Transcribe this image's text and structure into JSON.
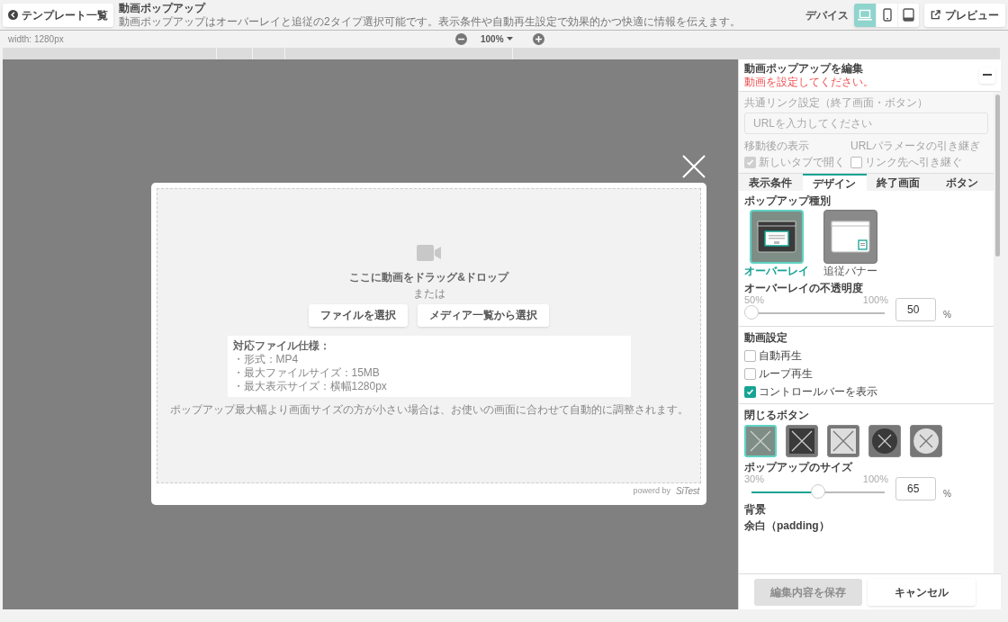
{
  "header": {
    "back_button": "テンプレート一覧",
    "title": "動画ポップアップ",
    "description": "動画ポップアップはオーバーレイと追従の2タイプ選択可能です。表示条件や自動再生設定で効果的かつ快適に情報を伝えます。",
    "device_label": "デバイス",
    "devices": [
      {
        "kind": "desktop",
        "selected": true
      },
      {
        "kind": "phone",
        "selected": false
      },
      {
        "kind": "tablet",
        "selected": false
      }
    ],
    "preview_button": "プレビュー"
  },
  "toolbar": {
    "width_label": "width: 1280px",
    "zoom": "100%"
  },
  "popup": {
    "drop_text": "ここに動画をドラッグ&ドロップ",
    "or_text": "または",
    "buttons": [
      "ファイルを選択",
      "メディア一覧から選択"
    ],
    "spec_title": "対応ファイル仕様：",
    "spec_items": [
      "・形式：MP4",
      "・最大ファイルサイズ：15MB",
      "・最大表示サイズ：横幅1280px"
    ],
    "note": "ポップアップ最大幅より画面サイズの方が小さい場合は、お使いの画面に合わせて自動的に調整されます。",
    "powered_by": "powerd by",
    "brand": "SiTest"
  },
  "panel": {
    "title": "動画ポップアップを編集",
    "warning": "動画を設定してください。",
    "link": {
      "label": "共通リンク設定（終了画面・ボタン）",
      "placeholder": "URLを入力してください",
      "after_label": "移動後の表示",
      "after_option": {
        "label": "新しいタブで開く",
        "checked": true
      },
      "param_label": "URLパラメータの引き継ぎ",
      "param_option": {
        "label": "リンク先へ引き継ぐ",
        "checked": false
      }
    },
    "tabs": [
      {
        "label": "表示条件",
        "selected": false
      },
      {
        "label": "デザイン",
        "selected": true
      },
      {
        "label": "終了画面",
        "selected": false
      },
      {
        "label": "ボタン",
        "selected": false
      }
    ],
    "popup_type": {
      "label": "ポップアップ種別",
      "options": [
        {
          "kind": "overlay",
          "label": "オーバーレイ",
          "selected": true
        },
        {
          "kind": "banner",
          "label": "追従バナー",
          "selected": false
        }
      ]
    },
    "opacity": {
      "label": "オーバーレイの不透明度",
      "min": "50%",
      "max": "100%",
      "level": 0,
      "value": "50",
      "unit": "%"
    },
    "video": {
      "label": "動画設定",
      "options": [
        {
          "label": "自動再生",
          "checked": false
        },
        {
          "label": "ループ再生",
          "checked": false
        },
        {
          "label": "コントロールバーを表示",
          "checked": true
        }
      ]
    },
    "close_button": {
      "label": "閉じるボタン",
      "options": [
        {
          "kind": "square-clear",
          "selected": true
        },
        {
          "kind": "square-dark",
          "selected": false
        },
        {
          "kind": "square-light",
          "selected": false
        },
        {
          "kind": "circle-dark",
          "selected": false
        },
        {
          "kind": "circle-light",
          "selected": false
        }
      ]
    },
    "size": {
      "label": "ポップアップのサイズ",
      "min": "30%",
      "max": "100%",
      "level": 0.5,
      "value": "65",
      "unit": "%"
    },
    "background_label": "背景",
    "padding_label": "余白（padding）",
    "save_button": {
      "label": "編集内容を保存",
      "disabled": true
    },
    "cancel_button": "キャンセル"
  }
}
